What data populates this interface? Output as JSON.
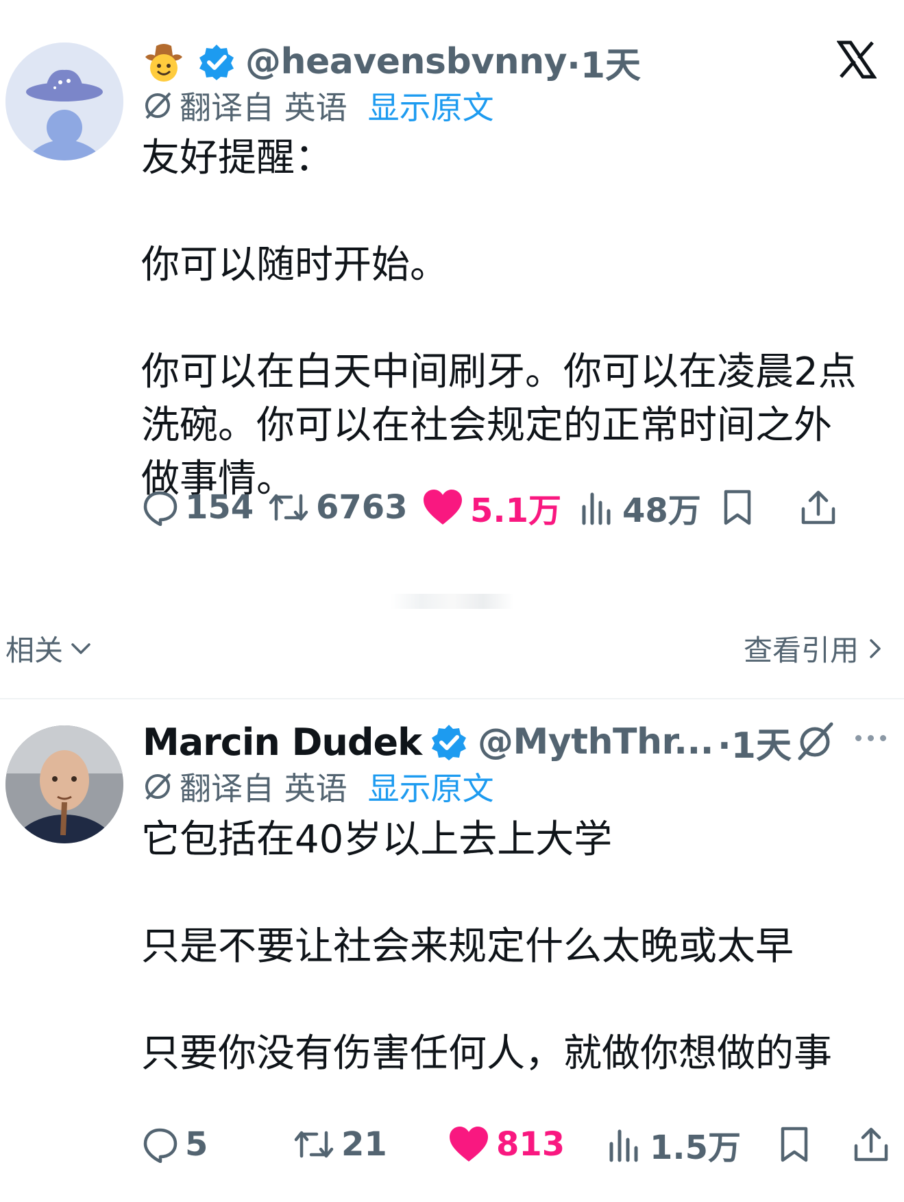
{
  "tweet1": {
    "handle": "@heavensbvnny",
    "time": "·1天",
    "translated_from": "翻译自 英语",
    "show_original": "显示原文",
    "text": "友好提醒：\n\n你可以随时开始。\n\n你可以在白天中间刷牙。你可以在凌晨2点\n洗碗。你可以在社会规定的正常时间之外\n做事情。",
    "replies": "154",
    "retweets": "6763",
    "likes": "5.1万",
    "views": "48万"
  },
  "related_label": "相关",
  "view_quotes_label": "查看引用",
  "tweet2": {
    "name": "Marcin Dudek",
    "handle": "@MythThr...",
    "time": "·1天",
    "translated_from": "翻译自 英语",
    "show_original": "显示原文",
    "text": "它包括在40岁以上去上大学\n\n只是不要让社会来规定什么太晚或太早\n\n只要你没有伤害任何人，就做你想做的事",
    "replies": "5",
    "retweets": "21",
    "likes": "813",
    "views": "1.5万"
  },
  "colors": {
    "accent": "#1d9bf0",
    "like": "#f91880",
    "muted": "#536471",
    "text": "#0f1419"
  },
  "icons": [
    "x-logo-icon",
    "verified-badge-icon",
    "cowboy-emoji-icon",
    "translate-icon",
    "reply-icon",
    "retweet-icon",
    "heart-icon",
    "views-icon",
    "bookmark-icon",
    "share-icon",
    "chevron-down-icon",
    "chevron-right-icon",
    "grok-icon",
    "more-icon"
  ]
}
